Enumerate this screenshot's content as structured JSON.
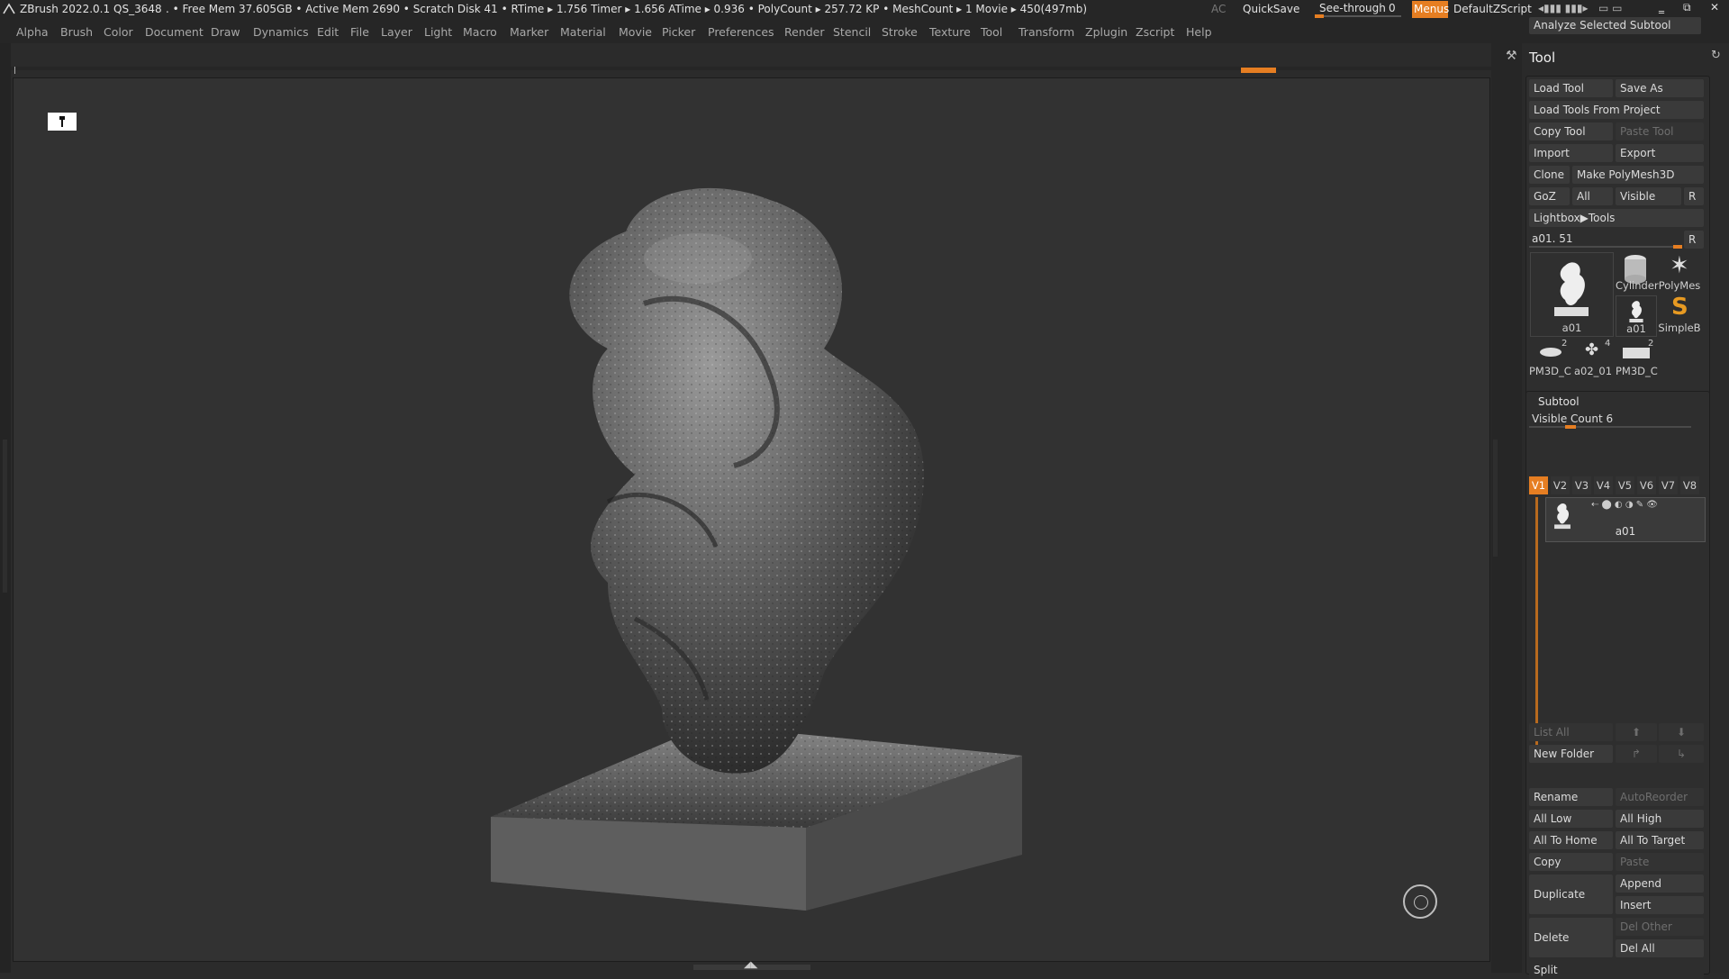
{
  "titlebar": {
    "app": "ZBrush 2022.0.1",
    "doc": "QS_3648",
    "stats": ". • Free Mem 37.605GB • Active Mem 2690 • Scratch Disk 41 •  RTime ▸ 1.756 Timer ▸ 1.656 ATime ▸ 0.936 • PolyCount ▸ 257.72 KP  • MeshCount ▸ 1  Movie ▸ 450(497mb)",
    "ac": "AC",
    "quicksave": "QuickSave",
    "seethrough_label": "See-through",
    "seethrough_value": "0",
    "seethrough_level": 0,
    "menus": "Menus",
    "script": "DefaultZScript",
    "analyze": "Analyze Selected Subtool"
  },
  "menu": [
    "Alpha",
    "Brush",
    "Color",
    "Document",
    "Draw",
    "Dynamics",
    "Edit",
    "File",
    "Layer",
    "Light",
    "Macro",
    "Marker",
    "Material",
    "Movie",
    "Picker",
    "Preferences",
    "Render",
    "Stencil",
    "Stroke",
    "Texture",
    "Tool",
    "Transform",
    "Zplugin",
    "Zscript",
    "Help"
  ],
  "tool": {
    "title": "Tool",
    "load_tool": "Load Tool",
    "save_as": "Save As",
    "load_from_project": "Load Tools From Project",
    "copy_tool": "Copy Tool",
    "paste_tool": "Paste Tool",
    "import": "Import",
    "export": "Export",
    "clone": "Clone",
    "make_polymesh": "Make PolyMesh3D",
    "goz": "GoZ",
    "all": "All",
    "visible": "Visible",
    "r": "R",
    "lightbox": "Lightbox▶Tools",
    "current": "a01. 51",
    "r2": "R",
    "thumbs": {
      "main": "a01",
      "cylinder": "Cylinder",
      "polymesh": "PolyMes",
      "a01_small": "a01",
      "simpleb": "SimpleB",
      "pm3d_1": "PM3D_C",
      "pm3d_1_count": "2",
      "a02": "a02_01",
      "a02_count": "4",
      "pm3d_2": "PM3D_C",
      "pm3d_2_count": "2"
    }
  },
  "subtool": {
    "title": "Subtool",
    "visible_count": "Visible Count 6",
    "tabs": [
      "V1",
      "V2",
      "V3",
      "V4",
      "V5",
      "V6",
      "V7",
      "V8"
    ],
    "active_tab": "V1",
    "item_name": "a01",
    "list_all": "List All",
    "new_folder": "New Folder",
    "rename": "Rename",
    "autoreorder": "AutoReorder",
    "all_low": "All Low",
    "all_high": "All High",
    "all_to_home": "All To Home",
    "all_to_target": "All To Target",
    "copy": "Copy",
    "paste": "Paste",
    "duplicate": "Duplicate",
    "append": "Append",
    "insert": "Insert",
    "delete": "Delete",
    "del_other": "Del Other",
    "del_all": "Del All",
    "split": "Split"
  },
  "colors": {
    "accent": "#e67e22",
    "background": "#2b2b2b",
    "viewport": "#323232",
    "button": "#3a3a3a"
  }
}
